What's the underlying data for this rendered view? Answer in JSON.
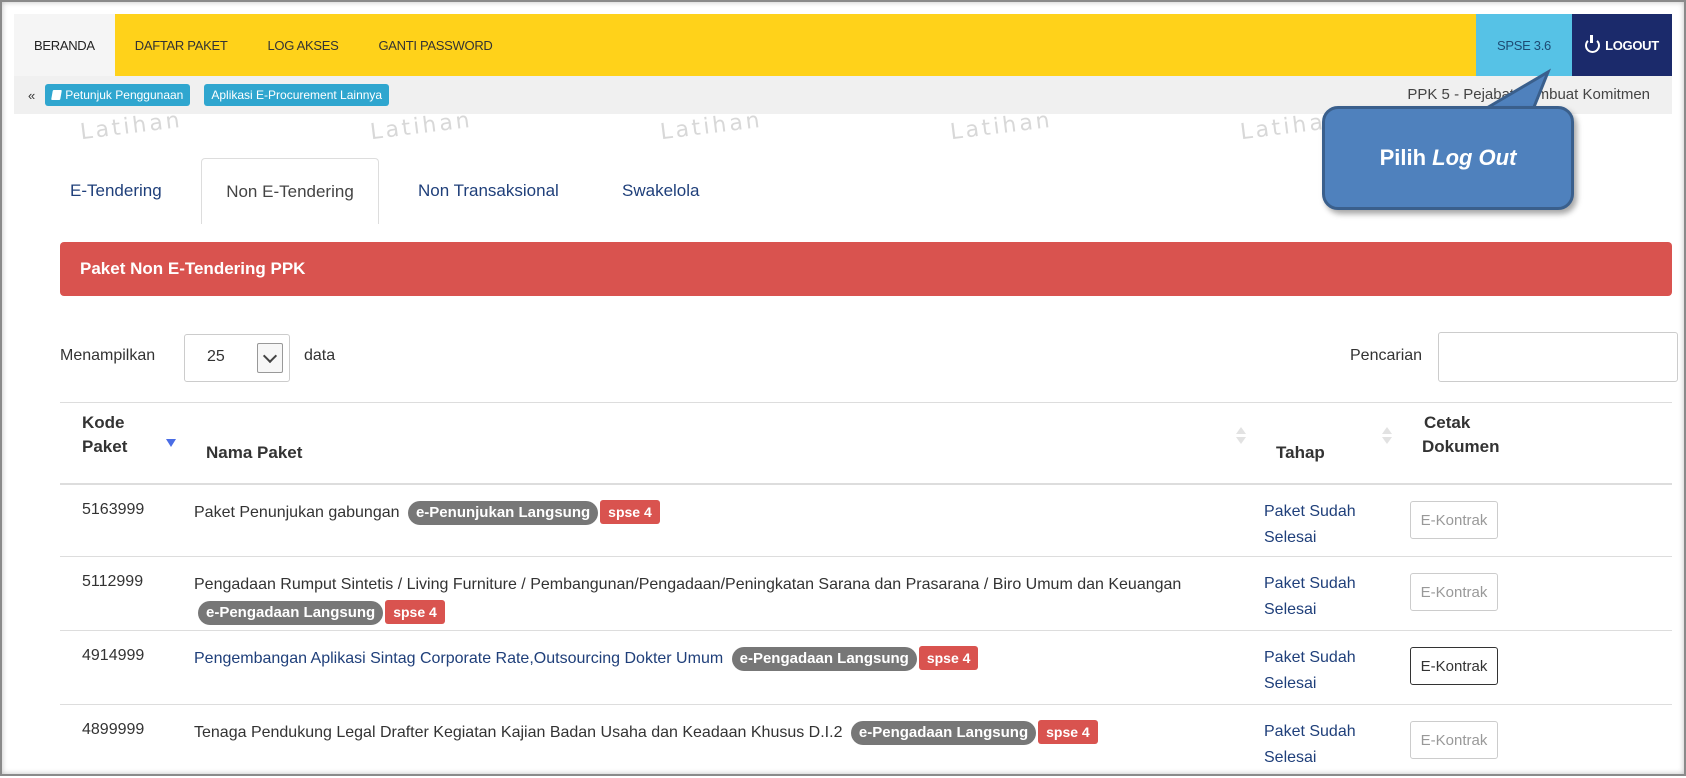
{
  "topnav": {
    "items": [
      "BERANDA",
      "DAFTAR PAKET",
      "LOG AKSES",
      "GANTI PASSWORD"
    ],
    "version": "SPSE 3.6",
    "logout": "LOGOUT"
  },
  "subbar": {
    "toggle": "«",
    "links": [
      "Petunjuk Penggunaan",
      "Aplikasi E-Procurement Lainnya"
    ],
    "role": "PPK 5 - Pejabat Pembuat Komitmen"
  },
  "watermark": "Latihan",
  "tabs": [
    "E-Tendering",
    "Non E-Tendering",
    "Non Transaksional",
    "Swakelola"
  ],
  "panel": {
    "title": "Paket Non E-Tendering PPK"
  },
  "controls": {
    "show_label": "Menampilkan",
    "page_size": "25",
    "data_label": "data",
    "search_label": "Pencarian",
    "search_value": ""
  },
  "table": {
    "headers": {
      "code_line1": "Kode",
      "code_line2": "Paket",
      "name": "Nama Paket",
      "stage": "Tahap",
      "print_line1": "Cetak",
      "print_line2": "Dokumen"
    },
    "rows": [
      {
        "code": "5163999",
        "name": "Paket Penunjukan gabungan",
        "method": "e-Penunjukan Langsung",
        "version": "spse 4",
        "stage": "Paket Sudah Selesai",
        "action": "E-Kontrak"
      },
      {
        "code": "5112999",
        "name": "Pengadaan Rumput Sintetis / Living Furniture / Pembangunan/Pengadaan/Peningkatan Sarana dan Prasarana / Biro Umum dan Keuangan",
        "method": "e-Pengadaan Langsung",
        "version": "spse 4",
        "stage": "Paket Sudah Selesai",
        "action": "E-Kontrak"
      },
      {
        "code": "4914999",
        "name": "Pengembangan Aplikasi Sintag Corporate Rate,Outsourcing Dokter Umum",
        "method": "e-Pengadaan Langsung",
        "version": "spse 4",
        "stage": "Paket Sudah Selesai",
        "action": "E-Kontrak"
      },
      {
        "code": "4899999",
        "name": "Tenaga Pendukung Legal Drafter Kegiatan Kajian Badan Usaha dan Keadaan Khusus D.I.2",
        "method": "e-Pengadaan Langsung",
        "version": "spse 4",
        "stage": "Paket Sudah Selesai",
        "action": "E-Kontrak"
      }
    ]
  },
  "callout": {
    "prefix": "Pilih ",
    "emphasis": "Log Out"
  },
  "colors": {
    "nav_bg": "#ffd21a",
    "logout_bg": "#1b2a6b",
    "version_bg": "#56c2e6",
    "panel_header": "#d9534f",
    "link": "#1f3f7a",
    "callout": "#4f81bd"
  }
}
